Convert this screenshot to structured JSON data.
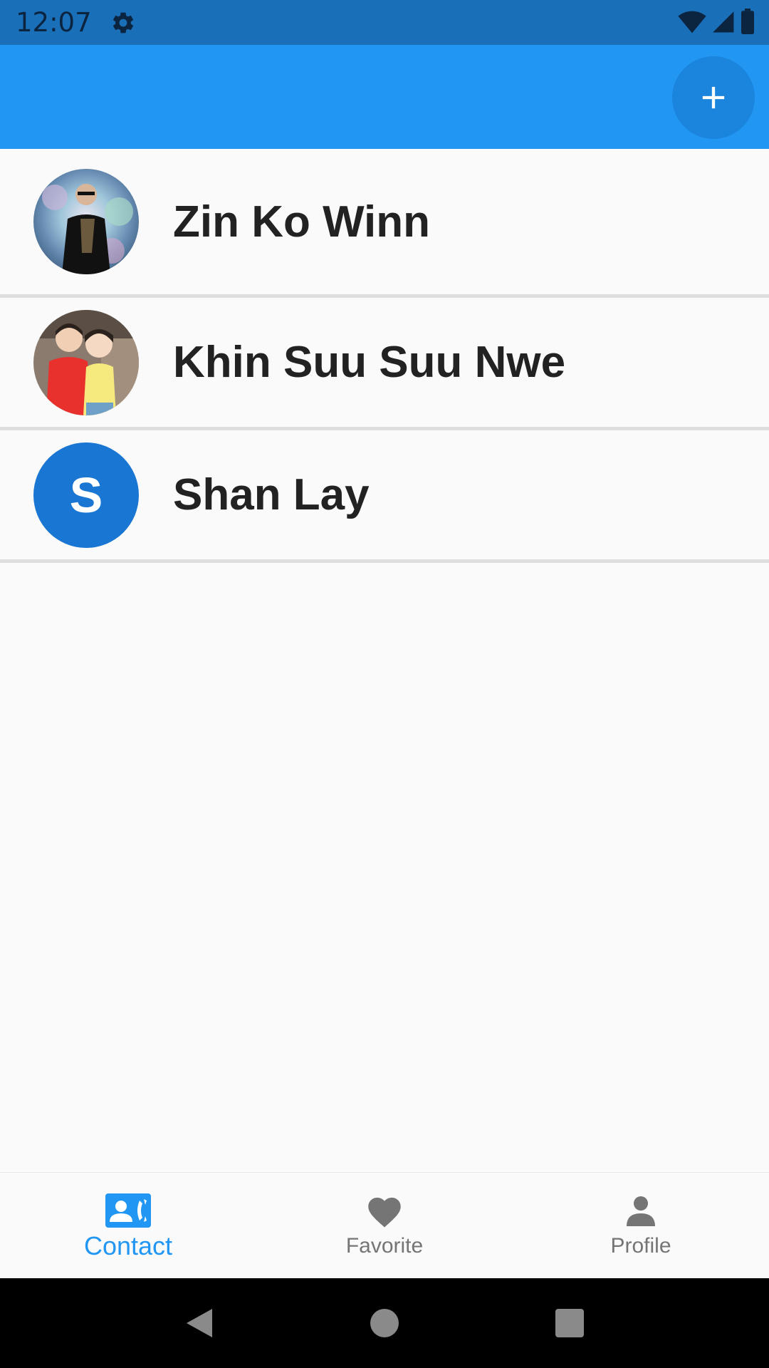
{
  "status_bar": {
    "time": "12:07",
    "icons": [
      "settings-icon",
      "wifi-icon",
      "signal-icon",
      "battery-icon"
    ]
  },
  "app_bar": {
    "add_button_icon": "plus-icon",
    "background_color": "#2196f3"
  },
  "contacts": [
    {
      "name": "Zin Ko Winn",
      "avatar_type": "photo"
    },
    {
      "name": "Khin Suu Suu Nwe",
      "avatar_type": "photo"
    },
    {
      "name": "Shan Lay",
      "avatar_type": "letter",
      "avatar_letter": "S",
      "avatar_color": "#1976d2"
    }
  ],
  "bottom_nav": {
    "items": [
      {
        "label": "Contact",
        "icon": "contact-phone-icon",
        "active": true
      },
      {
        "label": "Favorite",
        "icon": "heart-icon",
        "active": false
      },
      {
        "label": "Profile",
        "icon": "person-icon",
        "active": false
      }
    ],
    "active_color": "#2196f3",
    "inactive_color": "#757575"
  },
  "system_nav": [
    "back-icon",
    "home-icon",
    "recents-icon"
  ]
}
